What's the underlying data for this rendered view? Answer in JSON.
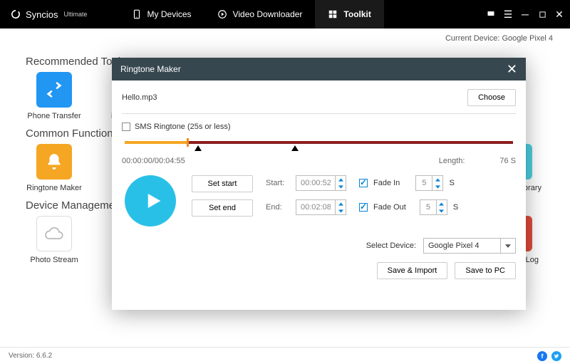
{
  "brand": {
    "name": "Syncios",
    "edition": "Ultimate"
  },
  "nav": {
    "devices": "My Devices",
    "video": "Video Downloader",
    "toolkit": "Toolkit"
  },
  "current_device_label": "Current Device:",
  "current_device_value": "Google Pixel 4",
  "sections": {
    "recommended": "Recommended Tools",
    "common": "Common Functions",
    "device_mgmt": "Device Management"
  },
  "tiles": {
    "phone_transfer": "Phone Transfer",
    "ios_prefix": "iOS",
    "ringtone_maker": "Ringtone Maker",
    "library_suffix": "Library",
    "photo_stream": "Photo Stream",
    "log_suffix": "Log"
  },
  "footer": {
    "version_label": "Version:",
    "version_value": "6.6.2"
  },
  "modal": {
    "title": "Ringtone Maker",
    "file_name": "Hello.mp3",
    "choose": "Choose",
    "sms_label": "SMS Ringtone (25s or less)",
    "time_pos": "00:00:00/00:04:55",
    "length_label": "Length:",
    "length_value": "76 S",
    "set_start": "Set start",
    "set_end": "Set end",
    "start_label": "Start:",
    "end_label": "End:",
    "start_value": "00:00:52",
    "end_value": "00:02:08",
    "fade_in": "Fade In",
    "fade_out": "Fade Out",
    "fade_in_sec": "5",
    "fade_out_sec": "5",
    "sec_unit": "S",
    "select_device": "Select Device:",
    "selected_device": "Google Pixel 4",
    "save_import": "Save & Import",
    "save_pc": "Save to PC"
  }
}
